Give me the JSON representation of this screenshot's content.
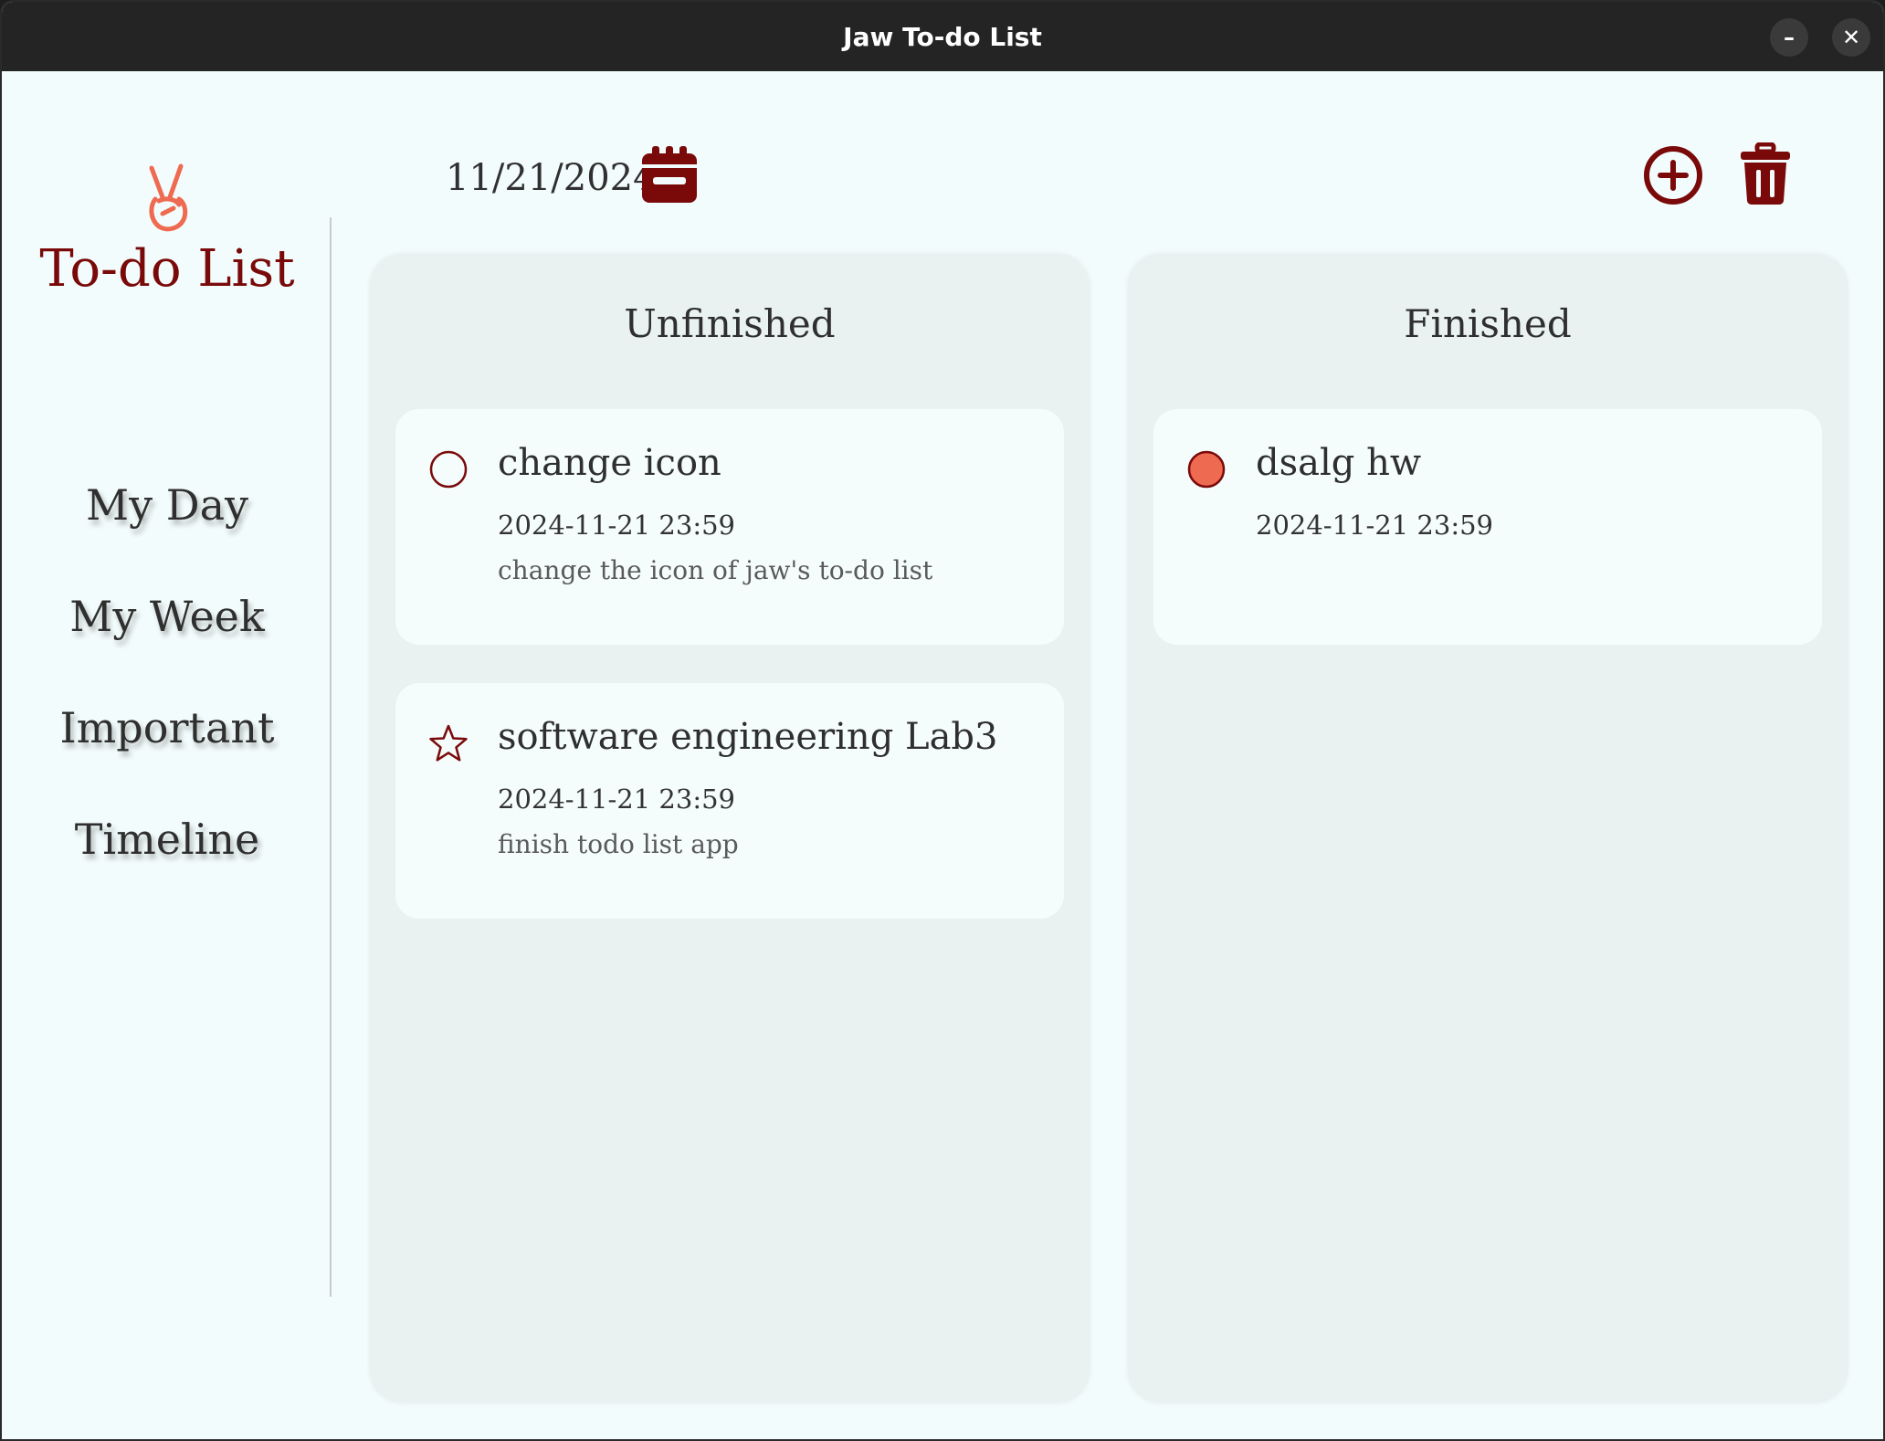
{
  "window": {
    "title": "Jaw To-do List",
    "minimize_glyph": "–",
    "close_glyph": "✕"
  },
  "sidebar": {
    "app_title": "To-do List",
    "logo_icon": "victory-hand-icon",
    "nav": [
      {
        "label": "My Day"
      },
      {
        "label": "My Week"
      },
      {
        "label": "Important"
      },
      {
        "label": "Timeline"
      }
    ]
  },
  "toolbar": {
    "date": "11/21/2024",
    "calendar_icon": "calendar-icon",
    "add_icon": "add-circle-icon",
    "delete_icon": "trash-icon"
  },
  "columns": {
    "unfinished": {
      "title": "Unfinished",
      "tasks": [
        {
          "title": "change icon",
          "due": "2024-11-21 23:59",
          "description": "change the icon of jaw's to-do list",
          "marker": "circle-outline-icon"
        },
        {
          "title": "software engineering Lab3",
          "due": "2024-11-21 23:59",
          "description": "finish todo list app",
          "marker": "star-outline-icon"
        }
      ]
    },
    "finished": {
      "title": "Finished",
      "tasks": [
        {
          "title": "dsalg hw",
          "due": "2024-11-21 23:59",
          "marker": "circle-filled-icon"
        }
      ]
    }
  },
  "colors": {
    "accent": "#7a0a0a",
    "finished_marker": "#ee6a50",
    "background": "#f3fcfc",
    "panel": "#e9f1f1",
    "card": "#f4fcfc"
  }
}
